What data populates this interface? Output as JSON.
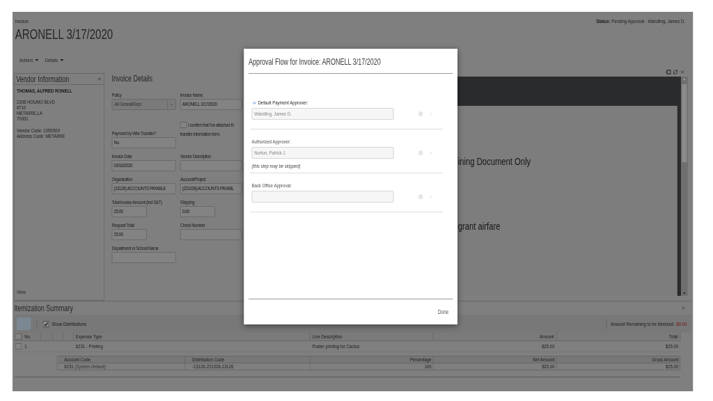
{
  "header": {
    "breadcrumb": "Invoice",
    "title": "ARONELL 3/17/2020",
    "status": "**Status:** Pending Approval - Wandling, James D."
  },
  "menu": [
    "Actions",
    "Details"
  ],
  "vendor_panel": {
    "title": "Vendor Information",
    "name": "THOMAS, ALFRED RONELL",
    "address": [
      "2308 HOUMO BLVD",
      "#710",
      "METAIRIE,LA",
      "70001"
    ],
    "codes": [
      "Vendor Code: 1055509",
      "Address Code: METAIRIE"
    ],
    "link": "View"
  },
  "invoice_details": {
    "title": "Invoice Details",
    "rows": [
      [
        {
          "kind": "select",
          "label": "Policy",
          "value": "All General/Dept",
          "disabled": true
        },
        {
          "kind": "text",
          "label": "Invoice Name",
          "value": "ARONELL 3/17/2020"
        }
      ],
      [
        {
          "kind": "text",
          "label": "Payment by Wire Transfer?",
          "value": "No."
        },
        {
          "kind": "checkbox",
          "label": "I confirm that I've attached th",
          "label_continued": "transfer information form.",
          "checked": false
        }
      ],
      [
        {
          "kind": "text",
          "label": "Invoice Date",
          "value": "03/16/2020"
        },
        {
          "kind": "text",
          "label": "Vendor Description"
        }
      ],
      [
        {
          "kind": "text",
          "label": "Organization",
          "value": "(13126) ACCOUNTS PAYABLE"
        },
        {
          "kind": "text",
          "label": "Account/Project",
          "value": "(221028) ACCOUNTS PAYABL"
        }
      ],
      [
        {
          "kind": "amount",
          "label": "Total Invoice Amount (incl S&T)",
          "value": "25.00"
        },
        {
          "kind": "amount",
          "label": "Shipping",
          "value": "0.00"
        }
      ],
      [
        {
          "kind": "amount",
          "label": "Request Total",
          "value": "25.00"
        },
        {
          "kind": "text",
          "label": "Check Number"
        }
      ],
      [
        {
          "kind": "text",
          "label": "Department or School Name"
        }
      ]
    ]
  },
  "document_viewer": {
    "lines": [
      "ining Document Only",
      "grant airfare"
    ]
  },
  "itemization": {
    "title": "Itemization Summary",
    "show_distributions": {
      "label": "Show Distributions",
      "checked": true
    },
    "remaining": {
      "label": "Amount Remaining to be Itemized:",
      "value": "$0.00"
    },
    "select_all_checked": false,
    "columns": [
      "No.",
      "Expense Type",
      "Line Description",
      "Amount",
      "Total"
    ],
    "rows": [
      {
        "selected": false,
        "cells": [
          "1",
          "6231 - Printing",
          "Poster printing for Cactus",
          "$25.00",
          "$25.00"
        ]
      }
    ],
    "distribution_columns": [
      "Account Code",
      "Distribution Code",
      "Percentage",
      "Net Amount",
      "Gross Amount"
    ],
    "distribution_rows": [
      [
        "6231 *(System Default)*",
        "-13126-221028-13126",
        "100",
        "$25.00",
        "$25.00"
      ]
    ]
  },
  "modal": {
    "title": "Approval Flow for Invoice: ARONELL 3/17/2020",
    "steps": [
      {
        "label": "Default Payment Approver:",
        "current": true,
        "value": "Wandling, James D."
      },
      {
        "label": "Authorized Approver:",
        "current": false,
        "value": "Norton, Patrick J.",
        "note": "(this step may be skipped)"
      },
      {
        "label": "Back Office Approval:",
        "current": false
      }
    ],
    "done": "Done"
  }
}
